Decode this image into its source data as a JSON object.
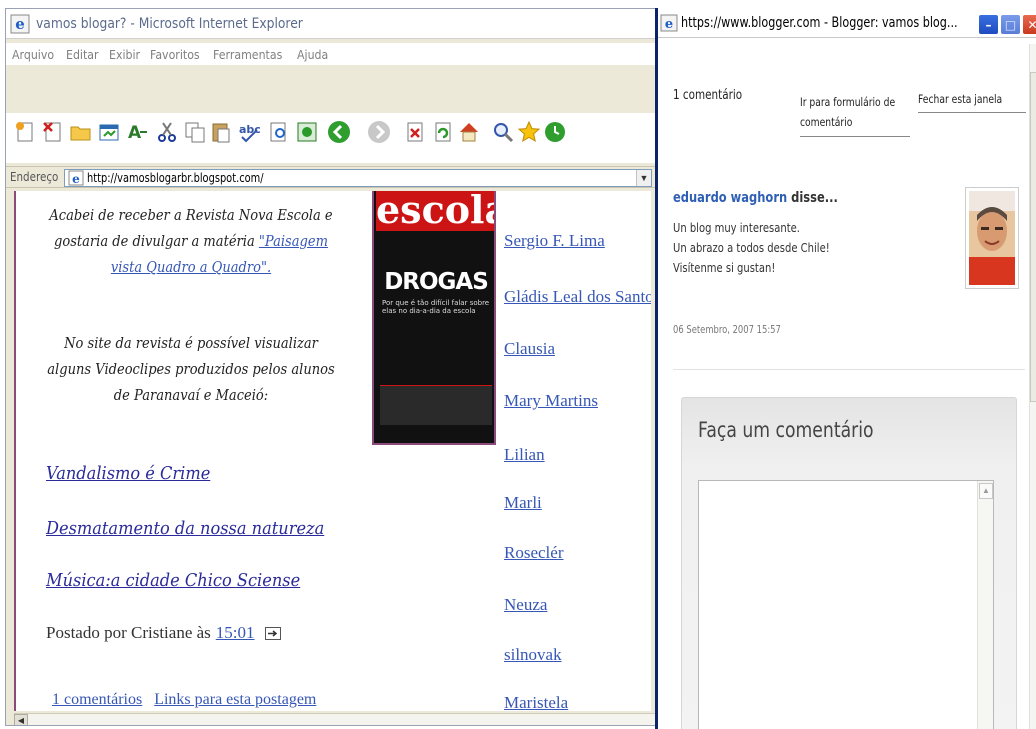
{
  "ie_window": {
    "title": "vamos blogar? - Microsoft Internet Explorer",
    "menu": [
      "Arquivo",
      "Editar",
      "Exibir",
      "Favoritos",
      "Ferramentas",
      "Ajuda"
    ],
    "address_label": "Endereço",
    "address_url": "http://vamosblogarbr.blogspot.com/"
  },
  "post": {
    "para1_prefix": "Acabei de receber a Revista Nova Escola e gostaria de divulgar a matéria ",
    "para1_link": "\"Paisagem vista Quadro a Quadro\".",
    "para2": "No site da revista é possível visualizar alguns Videoclipes produzidos pelos alunos de Paranavaí e Maceió:",
    "video_links": [
      "Vandalismo é Crime",
      "Desmatamento da nossa natureza",
      "Música:a cidade Chico Sciense"
    ],
    "posted_by": "Postado por Cristiane às",
    "posted_time": "15:01",
    "comments_link": "1 comentários",
    "backlinks": "Links para esta postagem"
  },
  "magazine": {
    "title": "escola",
    "headline": "DROGAS",
    "subhead": "Por que é tão difícil falar sobre elas no dia-a-dia da escola"
  },
  "followers": [
    "Sergio F. Lima",
    "Gládis Leal dos Santos",
    "Clausia",
    "Mary Martins",
    "Lilian",
    "Marli",
    "Roseclér",
    "Neuza",
    "silnovak",
    "Maristela"
  ],
  "blogger_window": {
    "title": "https://www.blogger.com - Blogger: vamos blog...",
    "comment_count": "1 comentário",
    "goto_form": [
      "Ir para formulário de",
      "comentário"
    ],
    "close_window": "Fechar esta janela",
    "comment": {
      "author": "eduardo waghorn",
      "said": "disse...",
      "lines": [
        "Un blog muy interesante.",
        "Un abrazo a todos desde Chile!",
        "Visítenme si gustan!"
      ],
      "date": "06 Setembro, 2007 15:57"
    },
    "form_title": "Faça um comentário"
  },
  "colors": {
    "link": "#3657b5",
    "title_bar": "#0a246a",
    "magazine_red": "#cc1414"
  }
}
